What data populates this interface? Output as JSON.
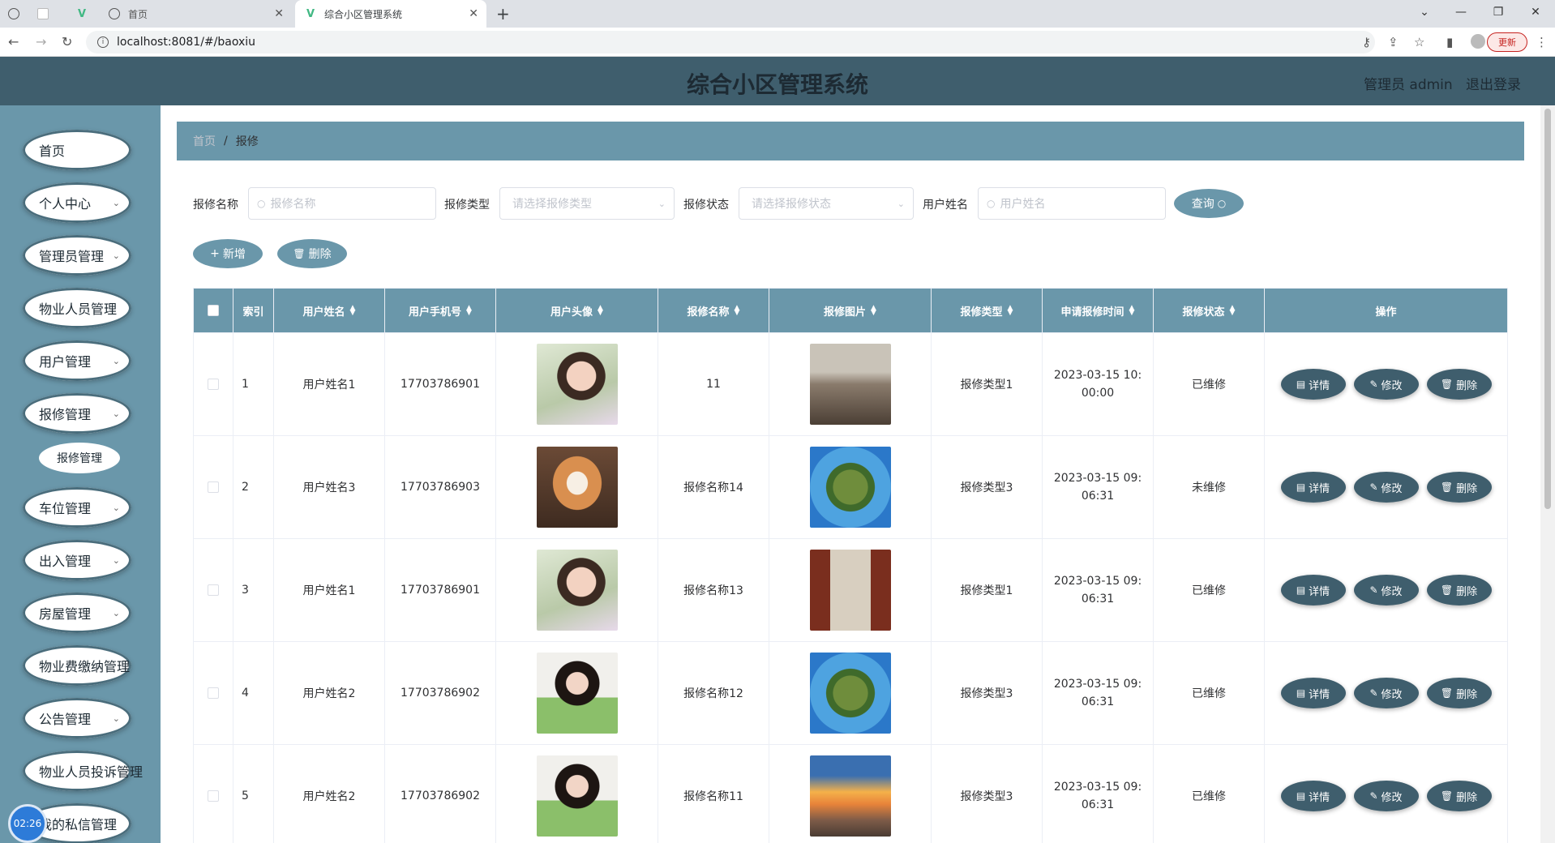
{
  "browser": {
    "tabs": [
      {
        "label": ""
      },
      {
        "label": ""
      },
      {
        "label": ""
      },
      {
        "label": "首页"
      },
      {
        "label": "综合小区管理系统"
      }
    ],
    "url": "localhost:8081/#/baoxiu",
    "update_label": "更新"
  },
  "header": {
    "title": "综合小区管理系统",
    "user": "管理员 admin",
    "logout": "退出登录"
  },
  "sidebar": {
    "items": [
      {
        "label": "首页",
        "chevron": false
      },
      {
        "label": "个人中心",
        "chevron": true
      },
      {
        "label": "管理员管理",
        "chevron": true
      },
      {
        "label": "物业人员管理",
        "chevron": false
      },
      {
        "label": "用户管理",
        "chevron": true
      },
      {
        "label": "报修管理",
        "chevron": true
      },
      {
        "label": "车位管理",
        "chevron": true
      },
      {
        "label": "出入管理",
        "chevron": true
      },
      {
        "label": "房屋管理",
        "chevron": true
      },
      {
        "label": "物业费缴纳管理",
        "chevron": false
      },
      {
        "label": "公告管理",
        "chevron": true
      },
      {
        "label": "物业人员投诉管理",
        "chevron": false
      },
      {
        "label": "我的私信管理",
        "chevron": false
      }
    ],
    "sub_item": "报修管理",
    "clock": "02:26"
  },
  "breadcrumb": {
    "home": "首页",
    "sep": "/",
    "current": "报修"
  },
  "search": {
    "name_label": "报修名称",
    "name_placeholder": "报修名称",
    "type_label": "报修类型",
    "type_placeholder": "请选择报修类型",
    "status_label": "报修状态",
    "status_placeholder": "请选择报修状态",
    "user_label": "用户姓名",
    "user_placeholder": "用户姓名",
    "query_button": "查询"
  },
  "actions": {
    "add": "新增",
    "delete": "删除"
  },
  "table": {
    "headers": [
      "索引",
      "用户姓名",
      "用户手机号",
      "用户头像",
      "报修名称",
      "报修图片",
      "报修类型",
      "申请报修时间",
      "报修状态",
      "操作"
    ],
    "rows": [
      {
        "index": "1",
        "name": "用户姓名1",
        "phone": "17703786901",
        "title": "11",
        "type": "报修类型1",
        "time": "2023-03-15 10:00:00",
        "status": "已维修",
        "avatar": "woman-flowers",
        "photo": "waterfall"
      },
      {
        "index": "2",
        "name": "用户姓名3",
        "phone": "17703786903",
        "title": "报修名称14",
        "type": "报修类型3",
        "time": "2023-03-15 09:06:31",
        "status": "未维修",
        "avatar": "shiba-dog",
        "photo": "tiny-planet"
      },
      {
        "index": "3",
        "name": "用户姓名1",
        "phone": "17703786901",
        "title": "报修名称13",
        "type": "报修类型1",
        "time": "2023-03-15 09:06:31",
        "status": "已维修",
        "avatar": "woman-flowers",
        "photo": "corridor"
      },
      {
        "index": "4",
        "name": "用户姓名2",
        "phone": "17703786902",
        "title": "报修名称12",
        "type": "报修类型3",
        "time": "2023-03-15 09:06:31",
        "status": "已维修",
        "avatar": "girl-green",
        "photo": "tiny-planet"
      },
      {
        "index": "5",
        "name": "用户姓名2",
        "phone": "17703786902",
        "title": "报修名称11",
        "type": "报修类型3",
        "time": "2023-03-15 09:06:31",
        "status": "已维修",
        "avatar": "girl-green",
        "photo": "sunset-beach"
      }
    ],
    "op_labels": {
      "detail": "详情",
      "edit": "修改",
      "delete": "删除"
    }
  },
  "colors": {
    "header": "#3f5e6d",
    "accent": "#6a97aa",
    "button": "#3f5e6d"
  }
}
